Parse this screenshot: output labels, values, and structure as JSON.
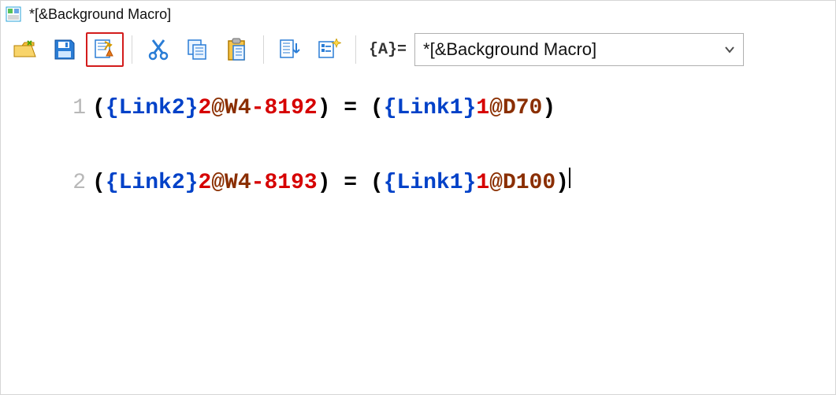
{
  "titlebar": {
    "text": "*[&Background Macro]"
  },
  "toolbar": {
    "var_label": "{A}=",
    "dropdown": {
      "selected": "*[&Background Macro]"
    }
  },
  "editor": {
    "lines": [
      {
        "number": "1",
        "tokens": [
          {
            "t": "(",
            "c": "black"
          },
          {
            "t": "{Link2}",
            "c": "blue"
          },
          {
            "t": "2",
            "c": "red"
          },
          {
            "t": "@W4",
            "c": "brown"
          },
          {
            "t": "-8192",
            "c": "red"
          },
          {
            "t": ") = (",
            "c": "black"
          },
          {
            "t": "{Link1}",
            "c": "blue"
          },
          {
            "t": "1",
            "c": "red"
          },
          {
            "t": "@D70",
            "c": "brown"
          },
          {
            "t": ")",
            "c": "black"
          }
        ]
      },
      {
        "number": "2",
        "tokens": [
          {
            "t": "(",
            "c": "black"
          },
          {
            "t": "{Link2}",
            "c": "blue"
          },
          {
            "t": "2",
            "c": "red"
          },
          {
            "t": "@W4",
            "c": "brown"
          },
          {
            "t": "-8193",
            "c": "red"
          },
          {
            "t": ") = (",
            "c": "black"
          },
          {
            "t": "{Link1}",
            "c": "blue"
          },
          {
            "t": "1",
            "c": "red"
          },
          {
            "t": "@D100",
            "c": "brown"
          },
          {
            "t": ")",
            "c": "black"
          }
        ],
        "cursor_after": true
      }
    ]
  }
}
